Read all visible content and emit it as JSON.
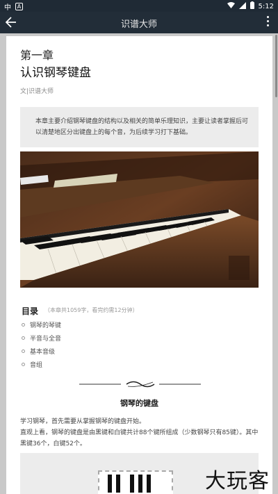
{
  "status_bar": {
    "left_icons": [
      "carrier-glyph",
      "notification-glyph"
    ],
    "carrier_glyph": "中",
    "notif_glyph": "A",
    "time": "5:12"
  },
  "app_bar": {
    "title": "识谱大师"
  },
  "article": {
    "chapter": "第一章",
    "title": "认识钢琴键盘",
    "author": "文|识谱大师",
    "intro": "本章主要介绍钢琴键盘的结构以及相关的简单乐理知识，主要让读者掌握后可以清楚地区分出键盘上的每个音，为后续学习打下基础。"
  },
  "toc": {
    "title": "目录",
    "meta": "（本章共1059字，看完约需12分钟）",
    "items": [
      "钢琴的琴键",
      "半音与全音",
      "基本音级",
      "音组"
    ]
  },
  "section": {
    "title": "钢琴的键盘",
    "paragraph1": "学习钢琴，首先需要从掌握钢琴的键盘开始。",
    "paragraph2": "直观上看，钢琴的键盘是由黑键和白键共计88个键所组成（少数钢琴只有85键）。其中黑键36个，白键52个。"
  },
  "watermark": "大玩客",
  "colors": {
    "status_bg": "#1f2a35",
    "appbar_bg": "#222d38",
    "page_bg": "#c9c9c9"
  }
}
